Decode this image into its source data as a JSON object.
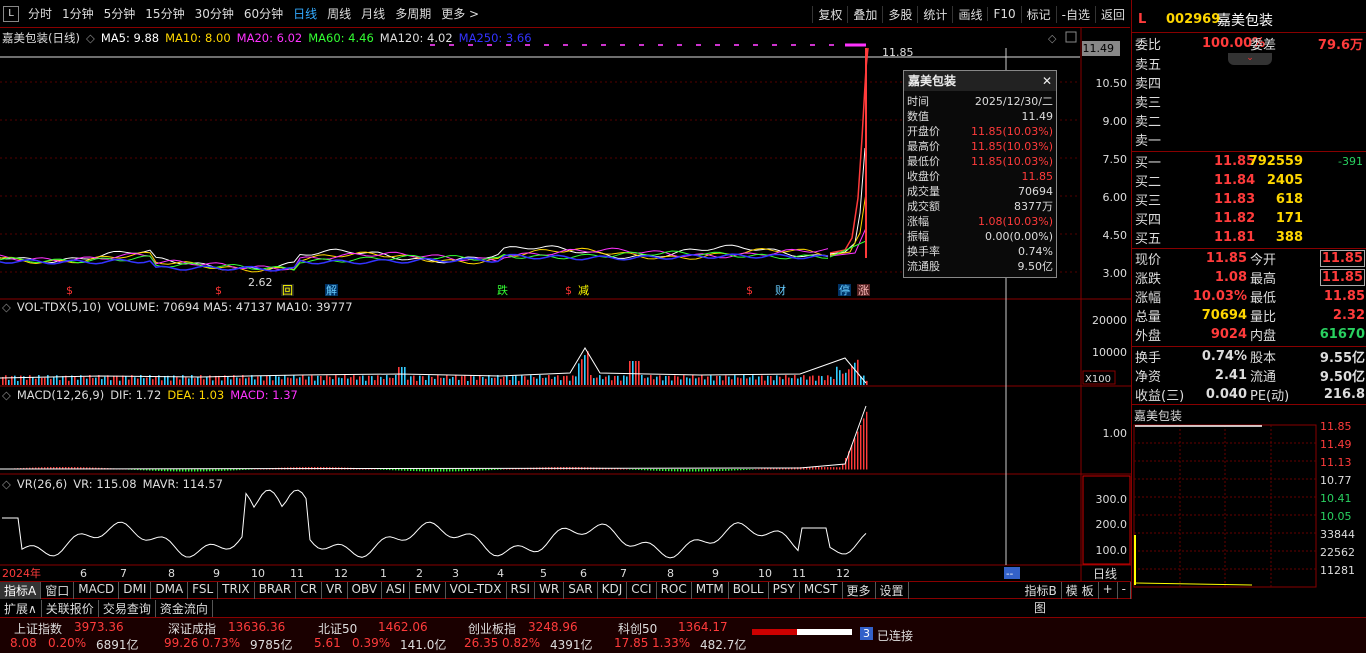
{
  "toolbar": {
    "logo": "L",
    "periods": [
      "分时",
      "1分钟",
      "5分钟",
      "15分钟",
      "30分钟",
      "60分钟",
      "日线",
      "周线",
      "月线",
      "多周期",
      "更多 >"
    ],
    "active_period": "日线",
    "right_items": [
      "复权",
      "叠加",
      "多股",
      "统计",
      "画线",
      "F10",
      "标记",
      "-自选",
      "返回"
    ]
  },
  "main_chart": {
    "title": "嘉美包装(日线)",
    "ma": [
      {
        "label": "MA5: 9.88",
        "color": "#ffffff"
      },
      {
        "label": "MA10: 8.00",
        "color": "#ffd700"
      },
      {
        "label": "MA20: 6.02",
        "color": "#ff33ff"
      },
      {
        "label": "MA60: 4.46",
        "color": "#33ff33"
      },
      {
        "label": "MA120: 4.02",
        "color": "#dddddd"
      },
      {
        "label": "MA250: 3.66",
        "color": "#3333ff"
      }
    ],
    "y_ticks": [
      "11.49",
      "10.50",
      "9.00",
      "7.50",
      "6.00",
      "4.50",
      "3.00"
    ],
    "current_price_tag": "11.49",
    "high_label": "11.85",
    "low_label": "2.62",
    "markers": [
      "回",
      "解",
      "跌",
      "减",
      "财",
      "停",
      "涨"
    ]
  },
  "popup": {
    "title": "嘉美包装",
    "rows": [
      {
        "k": "时间",
        "v": "2025/12/30/二",
        "c": "#dddddd"
      },
      {
        "k": "数值",
        "v": "11.49",
        "c": "#dddddd"
      },
      {
        "k": "开盘价",
        "v": "11.85(10.03%)",
        "c": "#ff3b3b"
      },
      {
        "k": "最高价",
        "v": "11.85(10.03%)",
        "c": "#ff3b3b"
      },
      {
        "k": "最低价",
        "v": "11.85(10.03%)",
        "c": "#ff3b3b"
      },
      {
        "k": "收盘价",
        "v": "11.85",
        "c": "#ff3b3b"
      },
      {
        "k": "成交量",
        "v": "70694",
        "c": "#dddddd"
      },
      {
        "k": "成交额",
        "v": "8377万",
        "c": "#dddddd"
      },
      {
        "k": "涨幅",
        "v": "1.08(10.03%)",
        "c": "#ff3b3b"
      },
      {
        "k": "振幅",
        "v": "0.00(0.00%)",
        "c": "#dddddd"
      },
      {
        "k": "换手率",
        "v": "0.74%",
        "c": "#dddddd"
      },
      {
        "k": "流通股",
        "v": "9.50亿",
        "c": "#dddddd"
      }
    ]
  },
  "vol": {
    "title": "VOL-TDX(5,10)",
    "values": "VOLUME: 70694  MA5: 47137  MA10: 39777",
    "y_ticks": [
      "20000",
      "10000"
    ],
    "unit": "X100"
  },
  "macd": {
    "title": "MACD(12,26,9)",
    "dif": "DIF: 1.72",
    "dea": "DEA: 1.03",
    "macd": "MACD: 1.37",
    "y_ticks": [
      "1.00"
    ]
  },
  "vr": {
    "title": "VR(26,6)",
    "vr": "VR: 115.08",
    "mavr": "MAVR: 114.57",
    "y_ticks": [
      "300.0",
      "200.0",
      "100.0"
    ]
  },
  "x_axis": {
    "labels": [
      "2024年",
      "6",
      "7",
      "8",
      "9",
      "10",
      "11",
      "12",
      "1",
      "2",
      "3",
      "4",
      "5",
      "6",
      "7",
      "8",
      "9",
      "10",
      "11",
      "12"
    ],
    "period_label": "日线"
  },
  "indicator_tabs": [
    "指标A",
    "窗口",
    "MACD",
    "DMI",
    "DMA",
    "FSL",
    "TRIX",
    "BRAR",
    "CR",
    "VR",
    "OBV",
    "ASI",
    "EMV",
    "VOL-TDX",
    "RSI",
    "WR",
    "SAR",
    "KDJ",
    "CCI",
    "ROC",
    "MTM",
    "BOLL",
    "PSY",
    "MCST",
    "更多",
    "设置"
  ],
  "indicator_right": [
    "指标B",
    "模 板",
    "+",
    "-"
  ],
  "sub_tabs": [
    "扩展∧",
    "关联报价",
    "交易查询",
    "资金流向"
  ],
  "quote": {
    "code": "002969",
    "name": "嘉美包装",
    "weibi_label": "委比",
    "weibi": "100.00%",
    "weicha_label": "委差",
    "weicha": "79.6万",
    "sells": [
      {
        "label": "卖五",
        "price": "",
        "vol": ""
      },
      {
        "label": "卖四",
        "price": "",
        "vol": ""
      },
      {
        "label": "卖三",
        "price": "",
        "vol": ""
      },
      {
        "label": "卖二",
        "price": "",
        "vol": ""
      },
      {
        "label": "卖一",
        "price": "",
        "vol": ""
      }
    ],
    "buys": [
      {
        "label": "买一",
        "price": "11.85",
        "vol": "792559",
        "chg": "-391"
      },
      {
        "label": "买二",
        "price": "11.84",
        "vol": "2405",
        "chg": ""
      },
      {
        "label": "买三",
        "price": "11.83",
        "vol": "618",
        "chg": ""
      },
      {
        "label": "买四",
        "price": "11.82",
        "vol": "171",
        "chg": ""
      },
      {
        "label": "买五",
        "price": "11.81",
        "vol": "388",
        "chg": ""
      }
    ],
    "stats": [
      {
        "l1": "现价",
        "v1": "11.85",
        "c1": "#ff3b3b",
        "l2": "今开",
        "v2": "11.85",
        "c2": "#ff3b3b",
        "box2": true
      },
      {
        "l1": "涨跌",
        "v1": "1.08",
        "c1": "#ff3b3b",
        "l2": "最高",
        "v2": "11.85",
        "c2": "#ff3b3b",
        "box2": true
      },
      {
        "l1": "涨幅",
        "v1": "10.03%",
        "c1": "#ff3b3b",
        "l2": "最低",
        "v2": "11.85",
        "c2": "#ff3b3b",
        "box2": false
      },
      {
        "l1": "总量",
        "v1": "70694",
        "c1": "#ffd700",
        "l2": "量比",
        "v2": "2.32",
        "c2": "#ff3b3b",
        "box2": false
      },
      {
        "l1": "外盘",
        "v1": "9024",
        "c1": "#ff3b3b",
        "l2": "内盘",
        "v2": "61670",
        "c2": "#29d160",
        "box2": false
      },
      {
        "l1": "换手",
        "v1": "0.74%",
        "c1": "#dddddd",
        "l2": "股本",
        "v2": "9.55亿",
        "c2": "#dddddd",
        "box2": false
      },
      {
        "l1": "净资",
        "v1": "2.41",
        "c1": "#dddddd",
        "l2": "流通",
        "v2": "9.50亿",
        "c2": "#dddddd",
        "box2": false
      },
      {
        "l1": "收益(三)",
        "v1": "0.040",
        "c1": "#dddddd",
        "l2": "PE(动)",
        "v2": "216.8",
        "c2": "#dddddd",
        "box2": false
      }
    ]
  },
  "mini_chart": {
    "title": "嘉美包装",
    "price_ticks": [
      {
        "v": "11.85",
        "c": "#ff3b3b"
      },
      {
        "v": "11.49",
        "c": "#ff3b3b"
      },
      {
        "v": "11.13",
        "c": "#ff3b3b"
      },
      {
        "v": "10.77",
        "c": "#dddddd"
      },
      {
        "v": "10.41",
        "c": "#29d160"
      },
      {
        "v": "10.05",
        "c": "#29d160"
      }
    ],
    "vol_ticks": [
      "33844",
      "22562",
      "11281"
    ],
    "tab": "图"
  },
  "status": {
    "indices": [
      {
        "name": "上证指数",
        "value": "3973.36",
        "chg": "8.08",
        "pct": "0.20%",
        "amt": "6891亿",
        "color": "#ff3b3b"
      },
      {
        "name": "深证成指",
        "value": "13636.36",
        "chg": "99.26",
        "pct": "0.73%",
        "amt": "9785亿",
        "color": "#ff3b3b"
      },
      {
        "name": "北证50",
        "value": "1462.06",
        "chg": "5.61",
        "pct": "0.39%",
        "amt": "141.0亿",
        "color": "#ff3b3b"
      },
      {
        "name": "创业板指",
        "value": "3248.96",
        "chg": "26.35",
        "pct": "0.82%",
        "amt": "4391亿",
        "color": "#ff3b3b"
      },
      {
        "name": "科创50",
        "value": "1364.17",
        "chg": "17.85",
        "pct": "1.33%",
        "amt": "482.7亿",
        "color": "#ff3b3b"
      }
    ],
    "conn_num": "3",
    "conn_text": "已连接"
  }
}
